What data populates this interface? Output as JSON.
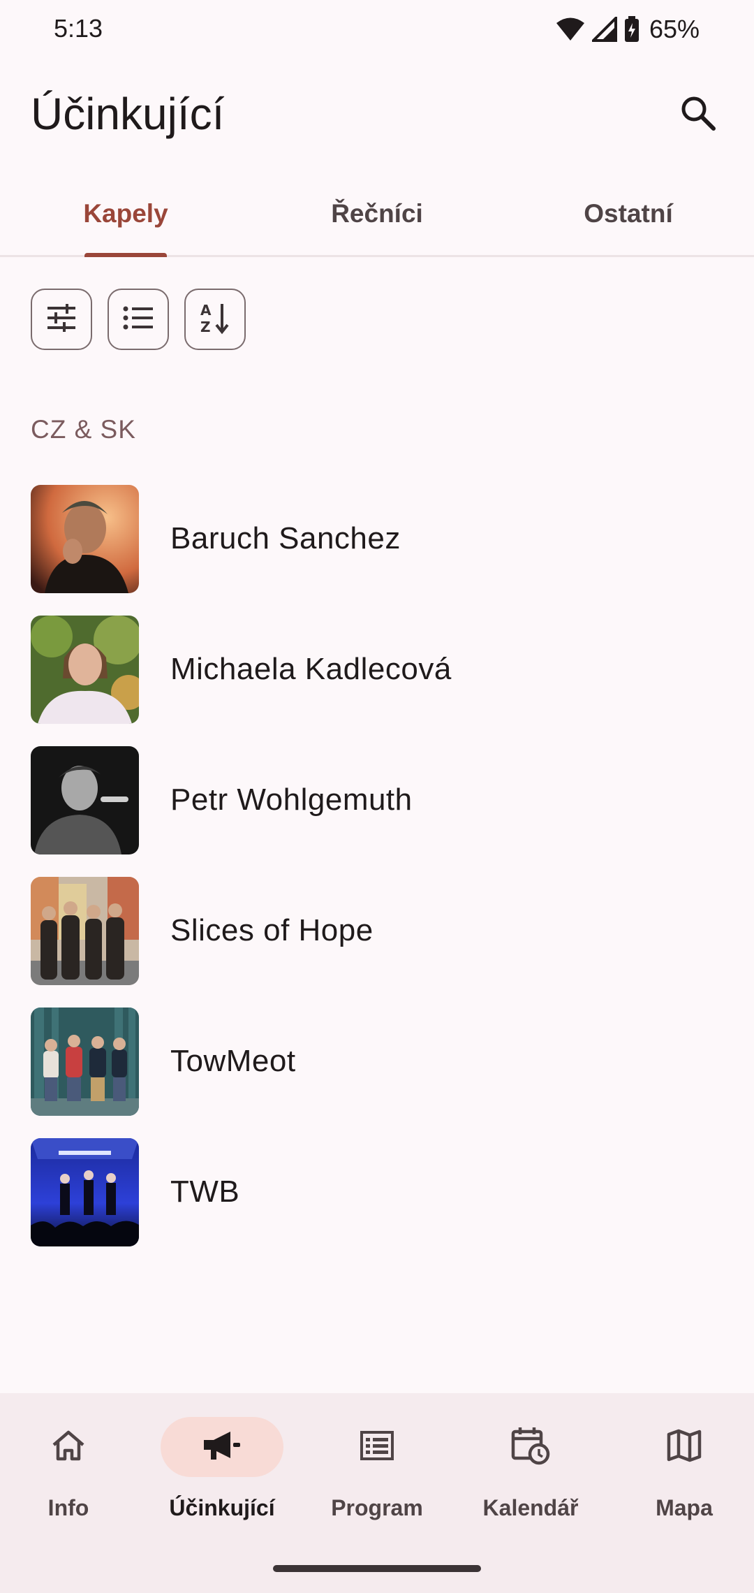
{
  "status": {
    "time": "5:13",
    "battery": "65%"
  },
  "header": {
    "title": "Účinkující",
    "search_icon": "search-icon"
  },
  "tabs": [
    {
      "label": "Kapely",
      "active": true
    },
    {
      "label": "Řečníci",
      "active": false
    },
    {
      "label": "Ostatní",
      "active": false
    }
  ],
  "filters": {
    "icons": [
      "tune-icon",
      "list-icon",
      "sort-az-icon"
    ]
  },
  "section": {
    "title": "CZ & SK"
  },
  "artists": [
    {
      "name": "Baruch Sanchez",
      "photo": "portrait"
    },
    {
      "name": "Michaela Kadlecová",
      "photo": "portrait"
    },
    {
      "name": "Petr Wohlgemuth",
      "photo": "portrait"
    },
    {
      "name": "Slices of Hope",
      "photo": "band"
    },
    {
      "name": "TowMeot",
      "photo": "band"
    },
    {
      "name": "TWB",
      "photo": "concert"
    }
  ],
  "nav": [
    {
      "label": "Info",
      "icon": "home-icon",
      "active": false
    },
    {
      "label": "Účinkující",
      "icon": "megaphone-icon",
      "active": true
    },
    {
      "label": "Program",
      "icon": "list-alt-icon",
      "active": false
    },
    {
      "label": "Kalendář",
      "icon": "calendar-clock-icon",
      "active": false
    },
    {
      "label": "Mapa",
      "icon": "map-icon",
      "active": false
    }
  ],
  "colors": {
    "background": "#fdf8fa",
    "accent": "#9a4639",
    "nav_background": "#f5ebee",
    "nav_active_pill": "#f8dbd6",
    "section_text": "#7b5b5e"
  }
}
